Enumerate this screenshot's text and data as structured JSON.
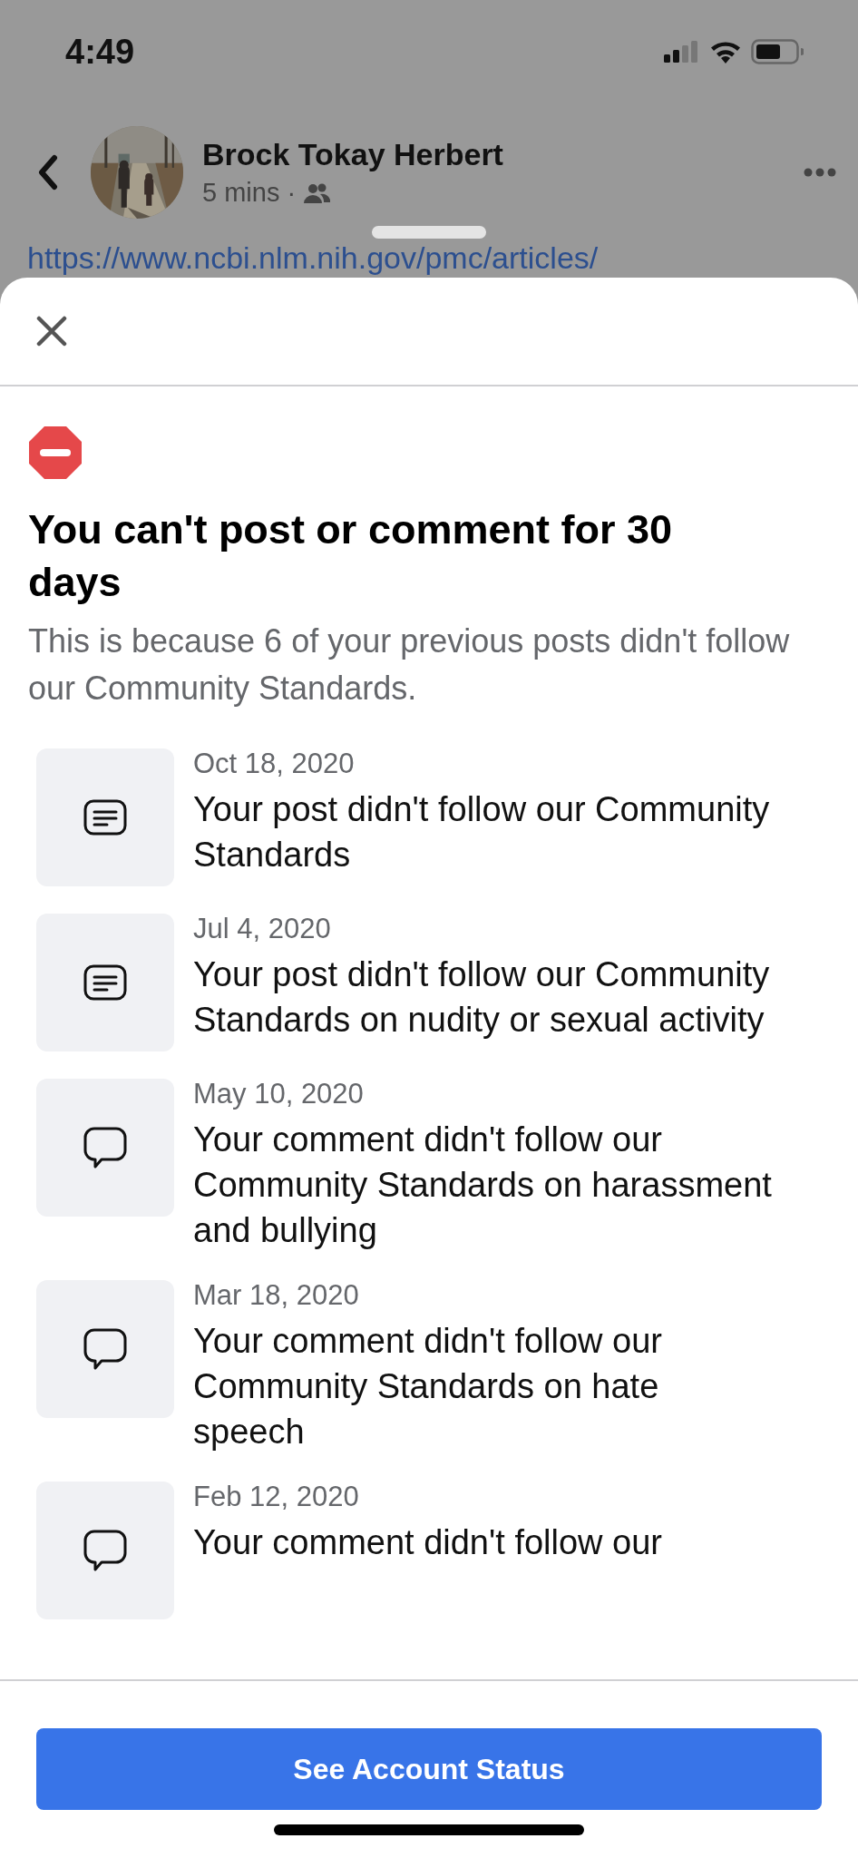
{
  "status_bar": {
    "time": "4:49"
  },
  "post_header": {
    "author": "Brock Tokay Herbert",
    "time": "5 mins",
    "separator": "·",
    "link": "https://www.ncbi.nlm.nih.gov/pmc/articles/"
  },
  "sheet": {
    "title": "You can't post or comment for 30 days",
    "description": "This is because 6 of your previous posts didn't follow our Community Standards.",
    "violations": [
      {
        "kind": "post",
        "date": "Oct 18, 2020",
        "text": "Your post didn't follow our Community Standards"
      },
      {
        "kind": "post",
        "date": "Jul 4, 2020",
        "text": "Your post didn't follow our Community Standards on nudity or sexual activity"
      },
      {
        "kind": "comment",
        "date": "May 10, 2020",
        "text": "Your comment didn't follow our Community Standards on harassment and bullying"
      },
      {
        "kind": "comment",
        "date": "Mar 18, 2020",
        "text": "Your comment didn't follow our Community Standards on hate speech"
      },
      {
        "kind": "comment",
        "date": "Feb 12, 2020",
        "text": "Your comment didn't follow our"
      }
    ],
    "button": "See Account Status"
  }
}
